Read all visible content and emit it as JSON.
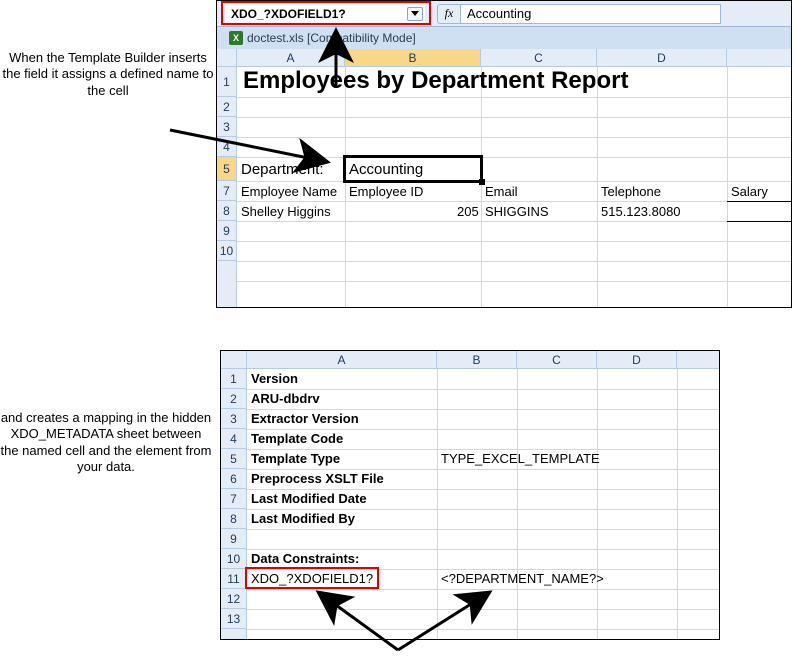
{
  "caption1": "When the Template Builder inserts the field it assigns a defined name to the cell",
  "caption2": "and creates a mapping in the hidden XDO_METADATA sheet between the named cell and the element from your data.",
  "top": {
    "name_box": "XDO_?XDOFIELD1?",
    "fx_label": "fx",
    "formula_value": "Accounting",
    "doc_icon_label": "X",
    "doc_title": "doctest.xls  [Compatibility Mode]",
    "cols": [
      "A",
      "B",
      "C",
      "D"
    ],
    "rows": [
      "1",
      "2",
      "3",
      "4",
      "5",
      "7",
      "8",
      "9",
      "10"
    ],
    "title": "Employees by Department Report",
    "department_label": "Department:",
    "department_value": "Accounting",
    "headers": {
      "emp_name": "Employee Name",
      "emp_id": "Employee ID",
      "email": "Email",
      "tel": "Telephone",
      "salary": "Salary"
    },
    "row8": {
      "emp_name": "Shelley Higgins",
      "emp_id": "205",
      "email": "SHIGGINS",
      "tel": "515.123.8080"
    }
  },
  "bottom": {
    "cols": [
      "A",
      "B",
      "C",
      "D"
    ],
    "rows": [
      "1",
      "2",
      "3",
      "4",
      "5",
      "6",
      "7",
      "8",
      "9",
      "10",
      "11",
      "12",
      "13"
    ],
    "labels": {
      "r1": "Version",
      "r2": "ARU-dbdrv",
      "r3": "Extractor Version",
      "r4": "Template Code",
      "r5": "Template Type",
      "r6": "Preprocess XSLT File",
      "r7": "Last Modified Date",
      "r8": "Last Modified By",
      "r10": "Data Constraints:",
      "r11a": "XDO_?XDOFIELD1?",
      "r11b": "<?DEPARTMENT_NAME?>"
    },
    "r5b": "TYPE_EXCEL_TEMPLATE"
  }
}
